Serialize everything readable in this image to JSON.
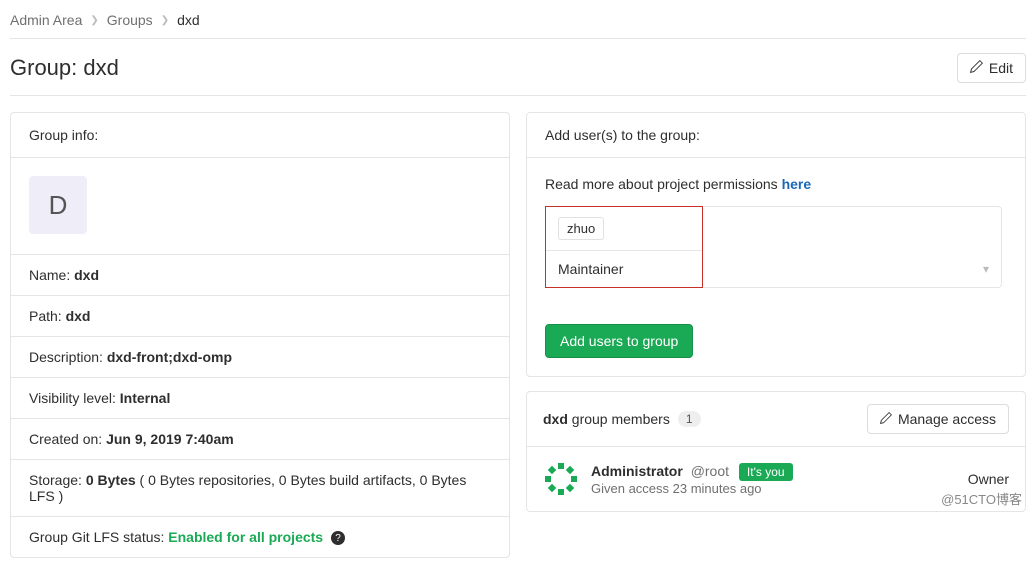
{
  "breadcrumb": {
    "admin": "Admin Area",
    "groups": "Groups",
    "current": "dxd"
  },
  "title": {
    "prefix": "Group: ",
    "name": "dxd",
    "edit_label": "Edit"
  },
  "group_info": {
    "header": "Group info:",
    "avatar_letter": "D",
    "name_label": "Name:",
    "name_value": "dxd",
    "path_label": "Path:",
    "path_value": "dxd",
    "desc_label": "Description:",
    "desc_value": "dxd-front;dxd-omp",
    "vis_label": "Visibility level:",
    "vis_value": "Internal",
    "created_label": "Created on:",
    "created_value": "Jun 9, 2019 7:40am",
    "storage_label": "Storage:",
    "storage_value": "0 Bytes",
    "storage_tail": " ( 0 Bytes repositories, 0 Bytes build artifacts, 0 Bytes LFS )",
    "lfs_label": "Group Git LFS status:",
    "lfs_value": "Enabled for all projects"
  },
  "add_users": {
    "header": "Add user(s) to the group:",
    "perm_text": "Read more about project permissions ",
    "perm_link": "here",
    "user_token": "zhuo",
    "role_value": "Maintainer",
    "submit_label": "Add users to group"
  },
  "members": {
    "title_strong": "dxd",
    "title_tail": " group members",
    "count": "1",
    "manage_label": "Manage access",
    "row": {
      "name": "Administrator",
      "handle": "@root",
      "you_label": "It's you",
      "sub": "Given access 23 minutes ago",
      "role": "Owner"
    }
  },
  "watermark": "@51CTO博客"
}
